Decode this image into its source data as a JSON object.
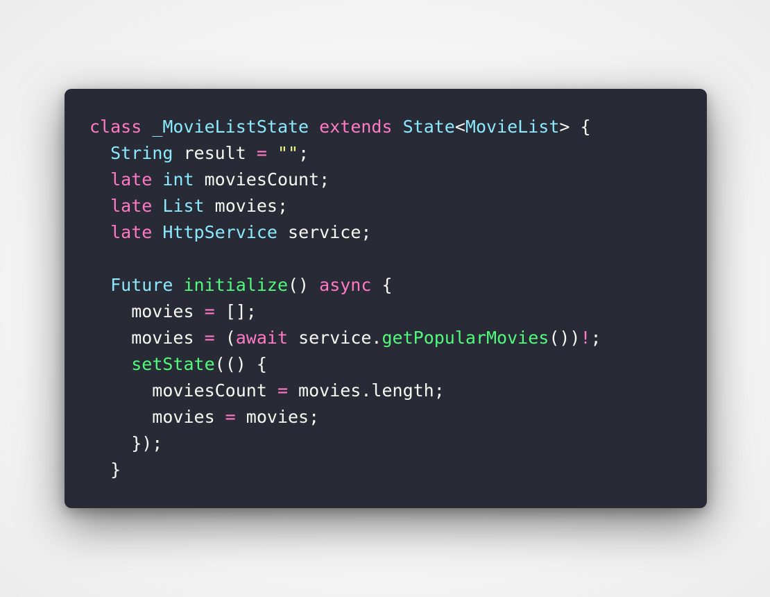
{
  "colors": {
    "background": "#282a36",
    "plain": "#f8f8f2",
    "keyword": "#ff79c6",
    "type": "#8be9fd",
    "function": "#50fa7b",
    "string": "#f1fa8c"
  },
  "code": {
    "language": "dart",
    "lines": [
      [
        {
          "t": "class",
          "k": "keyword"
        },
        {
          "t": " ",
          "k": "plain"
        },
        {
          "t": "_MovieListState",
          "k": "type"
        },
        {
          "t": " ",
          "k": "plain"
        },
        {
          "t": "extends",
          "k": "keyword"
        },
        {
          "t": " ",
          "k": "plain"
        },
        {
          "t": "State",
          "k": "type"
        },
        {
          "t": "<",
          "k": "plain"
        },
        {
          "t": "MovieList",
          "k": "type"
        },
        {
          "t": "> {",
          "k": "plain"
        }
      ],
      [
        {
          "t": "  ",
          "k": "plain"
        },
        {
          "t": "String",
          "k": "type"
        },
        {
          "t": " result ",
          "k": "plain"
        },
        {
          "t": "=",
          "k": "keyword"
        },
        {
          "t": " ",
          "k": "plain"
        },
        {
          "t": "\"\"",
          "k": "string"
        },
        {
          "t": ";",
          "k": "plain"
        }
      ],
      [
        {
          "t": "  ",
          "k": "plain"
        },
        {
          "t": "late",
          "k": "keyword"
        },
        {
          "t": " ",
          "k": "plain"
        },
        {
          "t": "int",
          "k": "type"
        },
        {
          "t": " moviesCount;",
          "k": "plain"
        }
      ],
      [
        {
          "t": "  ",
          "k": "plain"
        },
        {
          "t": "late",
          "k": "keyword"
        },
        {
          "t": " ",
          "k": "plain"
        },
        {
          "t": "List",
          "k": "type"
        },
        {
          "t": " movies;",
          "k": "plain"
        }
      ],
      [
        {
          "t": "  ",
          "k": "plain"
        },
        {
          "t": "late",
          "k": "keyword"
        },
        {
          "t": " ",
          "k": "plain"
        },
        {
          "t": "HttpService",
          "k": "type"
        },
        {
          "t": " service;",
          "k": "plain"
        }
      ],
      [],
      [
        {
          "t": "  ",
          "k": "plain"
        },
        {
          "t": "Future",
          "k": "type"
        },
        {
          "t": " ",
          "k": "plain"
        },
        {
          "t": "initialize",
          "k": "function"
        },
        {
          "t": "() ",
          "k": "plain"
        },
        {
          "t": "async",
          "k": "keyword"
        },
        {
          "t": " {",
          "k": "plain"
        }
      ],
      [
        {
          "t": "    movies ",
          "k": "plain"
        },
        {
          "t": "=",
          "k": "keyword"
        },
        {
          "t": " [];",
          "k": "plain"
        }
      ],
      [
        {
          "t": "    movies ",
          "k": "plain"
        },
        {
          "t": "=",
          "k": "keyword"
        },
        {
          "t": " (",
          "k": "plain"
        },
        {
          "t": "await",
          "k": "keyword"
        },
        {
          "t": " service.",
          "k": "plain"
        },
        {
          "t": "getPopularMovies",
          "k": "function"
        },
        {
          "t": "())",
          "k": "plain"
        },
        {
          "t": "!",
          "k": "keyword"
        },
        {
          "t": ";",
          "k": "plain"
        }
      ],
      [
        {
          "t": "    ",
          "k": "plain"
        },
        {
          "t": "setState",
          "k": "function"
        },
        {
          "t": "(() {",
          "k": "plain"
        }
      ],
      [
        {
          "t": "      moviesCount ",
          "k": "plain"
        },
        {
          "t": "=",
          "k": "keyword"
        },
        {
          "t": " movies.length;",
          "k": "plain"
        }
      ],
      [
        {
          "t": "      movies ",
          "k": "plain"
        },
        {
          "t": "=",
          "k": "keyword"
        },
        {
          "t": " movies;",
          "k": "plain"
        }
      ],
      [
        {
          "t": "    });",
          "k": "plain"
        }
      ],
      [
        {
          "t": "  }",
          "k": "plain"
        }
      ]
    ]
  }
}
